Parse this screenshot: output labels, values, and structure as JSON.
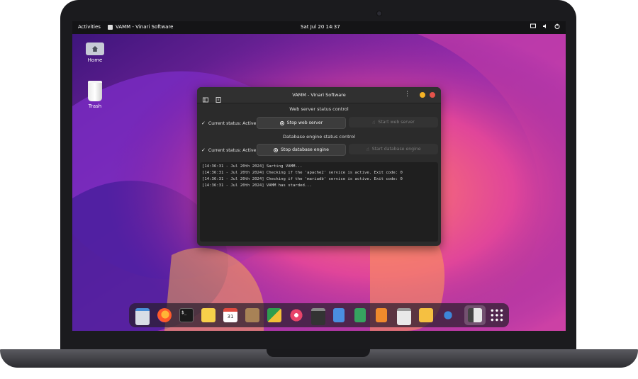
{
  "topbar": {
    "activities": "Activities",
    "app_name": "VAMM - Vinari Software",
    "clock": "Sat Jul 20  14:37"
  },
  "desktop": {
    "home_label": "Home",
    "trash_label": "Trash"
  },
  "window": {
    "title": "VAMM - Vinari Software",
    "web": {
      "section_title": "Web server status control",
      "status": "Current status: Active",
      "stop_label": "Stop web server",
      "start_label": "Start web server"
    },
    "db": {
      "section_title": "Database engine status control",
      "status": "Current status: Active",
      "stop_label": "Stop database engine",
      "start_label": "Start database engine"
    },
    "log": [
      "[14:36:31 - Jul 20th 2024] Sarting VAMM...",
      "[14:36:31 - Jul 20th 2024] Checking if the 'apache2' service is active. Exit code: 0",
      "[14:36:31 - Jul 20th 2024] Checking if the 'mariadb' service is active. Exit code: 0",
      "[14:36:31 - Jul 20th 2024] VAMM has starded..."
    ]
  },
  "dock": {
    "items": [
      "files-icon",
      "firefox-icon",
      "terminal-icon",
      "notes-icon",
      "calendar-icon",
      "contacts-icon",
      "store-icon",
      "photo-icon",
      "video-icon",
      "docs-icon",
      "sheets-icon",
      "slides-icon",
      "software-icon",
      "mail-icon",
      "settings-icon",
      "vamm-icon",
      "app-grid-icon"
    ],
    "calendar_day": "31"
  },
  "colors": {
    "window_bg": "#2b2b2b",
    "minimize": "#f5b325",
    "close": "#e5534b"
  }
}
